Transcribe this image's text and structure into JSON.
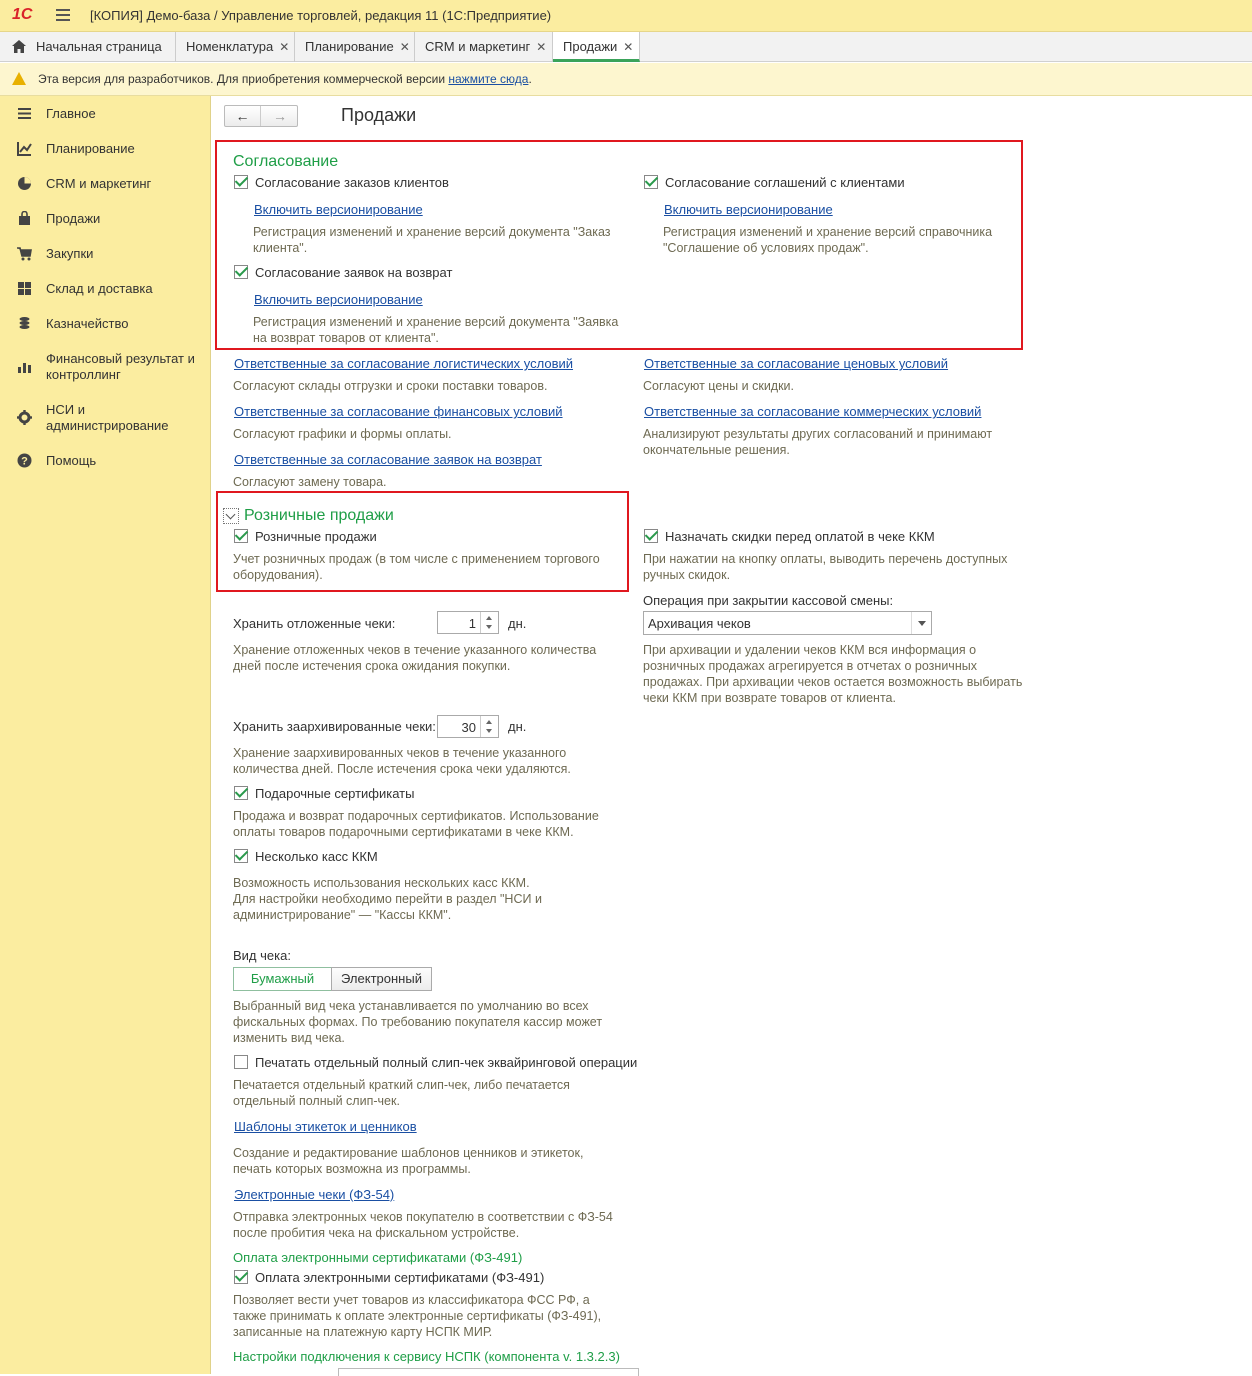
{
  "window": {
    "logo": "1С",
    "title": "[КОПИЯ] Демо-база / Управление торговлей, редакция 11  (1С:Предприятие)"
  },
  "tabs": [
    {
      "label": "Начальная страница"
    },
    {
      "label": "Номенклатура",
      "close": "✕"
    },
    {
      "label": "Планирование",
      "close": "✕"
    },
    {
      "label": "CRM и маркетинг",
      "close": "✕"
    },
    {
      "label": "Продажи",
      "close": "✕"
    }
  ],
  "notice": {
    "text": "Эта версия для разработчиков. Для приобретения коммерческой версии ",
    "link": "нажмите сюда",
    "tail": "."
  },
  "sidebar": {
    "items": [
      {
        "label": "Главное",
        "icon": "menu-icon"
      },
      {
        "label": "Планирование",
        "icon": "planning-icon"
      },
      {
        "label": "CRM и маркетинг",
        "icon": "pie-chart-icon"
      },
      {
        "label": "Продажи",
        "icon": "bag-icon"
      },
      {
        "label": "Закупки",
        "icon": "cart-icon"
      },
      {
        "label": "Склад и доставка",
        "icon": "warehouse-icon"
      },
      {
        "label": "Казначейство",
        "icon": "coins-icon"
      },
      {
        "label": "Финансовый результат и",
        "label2": "контроллинг",
        "icon": "bar-chart-icon"
      },
      {
        "label": "НСИ и",
        "label2": "администрирование",
        "icon": "gear-icon"
      },
      {
        "label": "Помощь",
        "icon": "help-icon"
      }
    ]
  },
  "page": {
    "title": "Продажи",
    "nav_back": "←",
    "nav_forward": "→"
  },
  "agreement": {
    "heading": "Согласование",
    "orders": {
      "label": "Согласование заказов клиентов",
      "checked": true,
      "link": "Включить версионирование",
      "desc1": "Регистрация изменений и хранение версий документа \"Заказ",
      "desc2": "клиента\"."
    },
    "agreements": {
      "label": "Согласование соглашений с клиентами",
      "checked": true,
      "link": "Включить версионирование",
      "desc1": "Регистрация изменений и хранение версий справочника",
      "desc2": "\"Соглашение об условиях продаж\"."
    },
    "returns": {
      "label": "Согласование заявок на возврат",
      "checked": true,
      "link": "Включить версионирование",
      "desc1": "Регистрация изменений и хранение версий документа \"Заявка",
      "desc2": "на возврат товаров от клиента\"."
    }
  },
  "responsible": {
    "logistics": {
      "link": "Ответственные за согласование логистических условий",
      "desc": "Согласуют склады отгрузки и сроки поставки товаров."
    },
    "prices": {
      "link": "Ответственные за согласование ценовых условий",
      "desc": "Согласуют цены и скидки."
    },
    "finance": {
      "link": "Ответственные за согласование финансовых условий",
      "desc": "Согласуют графики и формы оплаты."
    },
    "commercial": {
      "link": "Ответственные за согласование коммерческих условий",
      "desc1": "Анализируют результаты других согласований и принимают",
      "desc2": "окончательные решения."
    },
    "returns": {
      "link": "Ответственные за согласование заявок на возврат",
      "desc": "Согласуют замену товара."
    }
  },
  "retail": {
    "heading": "Розничные продажи",
    "enabled": {
      "label": "Розничные продажи",
      "checked": true,
      "desc1": "Учет розничных продаж (в том числе с применением торгового",
      "desc2": "оборудования)."
    },
    "discounts": {
      "label": "Назначать скидки перед оплатой в чеке ККМ",
      "checked": true,
      "desc1": "При нажатии на кнопку оплаты, выводить перечень доступных",
      "desc2": "ручных скидок."
    },
    "deferred": {
      "label": "Хранить отложенные чеки:",
      "value": "1",
      "unit": "дн.",
      "desc1": "Хранение отложенных чеков в течение указанного количества",
      "desc2": "дней после истечения срока ожидания покупки."
    },
    "closing": {
      "label": "Операция при закрытии кассовой смены:",
      "value": "Архивация чеков",
      "desc1": "При архивации и удалении чеков ККМ вся информация о",
      "desc2": "розничных продажах агрегируется в отчетах о розничных",
      "desc3": "продажах. При архивации чеков остается возможность выбирать",
      "desc4": "чеки ККМ при возврате товаров от клиента."
    },
    "archived": {
      "label": "Хранить заархивированные чеки:",
      "value": "30",
      "unit": "дн.",
      "desc1": "Хранение заархивированных чеков в течение указанного",
      "desc2": "количества дней. После истечения срока чеки удаляются."
    },
    "gift": {
      "label": "Подарочные сертификаты",
      "checked": true,
      "desc1": "Продажа и возврат подарочных сертификатов. Использование",
      "desc2": "оплаты товаров подарочными сертификатами в чеке ККМ."
    },
    "multi": {
      "label": "Несколько касс ККМ",
      "checked": true,
      "desc1": "Возможность использования нескольких касс ККМ.",
      "desc2": "Для настройки необходимо перейти в раздел \"НСИ и",
      "desc3": "администрирование\" — \"Кассы ККМ\"."
    },
    "receipt_type": {
      "label": "Вид чека:",
      "opt1": "Бумажный",
      "opt2": "Электронный",
      "selected": "Бумажный",
      "desc1": "Выбранный вид чека устанавливается по умолчанию во всех",
      "desc2": "фискальных формах. По требованию покупателя кассир может",
      "desc3": "изменить вид чека."
    },
    "slip": {
      "label": "Печатать отдельный полный слип-чек эквайринговой операции",
      "checked": false,
      "desc1": "Печатается отдельный краткий слип-чек, либо печатается",
      "desc2": "отдельный полный слип-чек."
    },
    "templates": {
      "link": "Шаблоны этикеток и ценников",
      "desc1": "Создание и редактирование шаблонов ценников и этикеток,",
      "desc2": "печать которых возможна из программы."
    },
    "ereceipts": {
      "link": "Электронные чеки (ФЗ-54)",
      "desc1": "Отправка электронных чеков покупателю в соответствии с ФЗ-54",
      "desc2": "после пробития чека на фискальном устройстве."
    },
    "ecert": {
      "heading": "Оплата электронными сертификатами (ФЗ-491)",
      "label": "Оплата электронными сертификатами (ФЗ-491)",
      "checked": true,
      "desc1": "Позволяет вести учет товаров из классификатора ФСС РФ, а",
      "desc2": "также принимать к оплате электронные сертификаты (ФЗ-491),",
      "desc3": "записанные на платежную карту НСПК МИР."
    },
    "nspk": {
      "heading": "Настройки подключения к сервису НСПК (компонента v. 1.3.2.3)"
    }
  },
  "colors": {
    "accent_green": "#1f9e47",
    "highlight_red": "#e0181f",
    "sidebar_bg": "#fbeda0",
    "link": "#1a4fa3"
  }
}
